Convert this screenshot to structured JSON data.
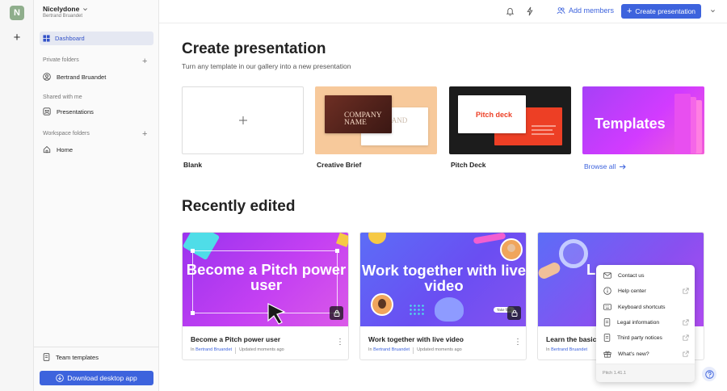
{
  "rail": {
    "logo_letter": "N"
  },
  "sidebar": {
    "workspace_name": "Nicelydone",
    "workspace_user": "Bertrand Bruandet",
    "dashboard_label": "Dashboard",
    "private_folders_label": "Private folders",
    "private_item": "Bertrand Bruandet",
    "shared_label": "Shared with me",
    "shared_item": "Presentations",
    "workspace_folders_label": "Workspace folders",
    "workspace_item": "Home",
    "team_templates_label": "Team templates",
    "download_label": "Download desktop app"
  },
  "topbar": {
    "add_members_label": "Add members",
    "create_label": "Create presentation"
  },
  "create": {
    "title": "Create presentation",
    "subtitle": "Turn any template in our gallery into a new presentation",
    "templates": [
      {
        "label": "Blank"
      },
      {
        "label": "Creative Brief",
        "thumb_text_1": "COMPANY NAME",
        "thumb_text_2": "OF BRAND"
      },
      {
        "label": "Pitch Deck",
        "thumb_text": "Pitch deck"
      },
      {
        "thumb_text": "Templates"
      }
    ],
    "browse_all": "Browse all"
  },
  "recent": {
    "title": "Recently edited",
    "cards": [
      {
        "thumb_title": "Become a Pitch power user",
        "title": "Become a Pitch power user",
        "in_label": "In",
        "owner": "Bertrand Bruandet",
        "updated": "Updated moments ago"
      },
      {
        "thumb_title": "Work together with live video",
        "title": "Work together with live video",
        "in_label": "In",
        "owner": "Bertrand Bruandet",
        "updated": "Updated moments ago",
        "pill": "Take five"
      },
      {
        "thumb_title": "Le",
        "title": "Learn the basics",
        "in_label": "In",
        "owner": "Bertrand Bruandet",
        "updated": ""
      }
    ]
  },
  "help_menu": {
    "items": [
      {
        "label": "Contact us",
        "icon": "mail-icon",
        "external": false
      },
      {
        "label": "Help center",
        "icon": "info-icon",
        "external": true
      },
      {
        "label": "Keyboard shortcuts",
        "icon": "keyboard-icon",
        "external": false
      },
      {
        "label": "Legal information",
        "icon": "document-icon",
        "external": true
      },
      {
        "label": "Third party notices",
        "icon": "document-icon",
        "external": true
      },
      {
        "label": "What's new?",
        "icon": "gift-icon",
        "external": true
      }
    ],
    "version": "Pitch 1.41.1"
  },
  "colors": {
    "accent": "#3d63dd",
    "dashboard_bg": "#e5e8f2"
  }
}
